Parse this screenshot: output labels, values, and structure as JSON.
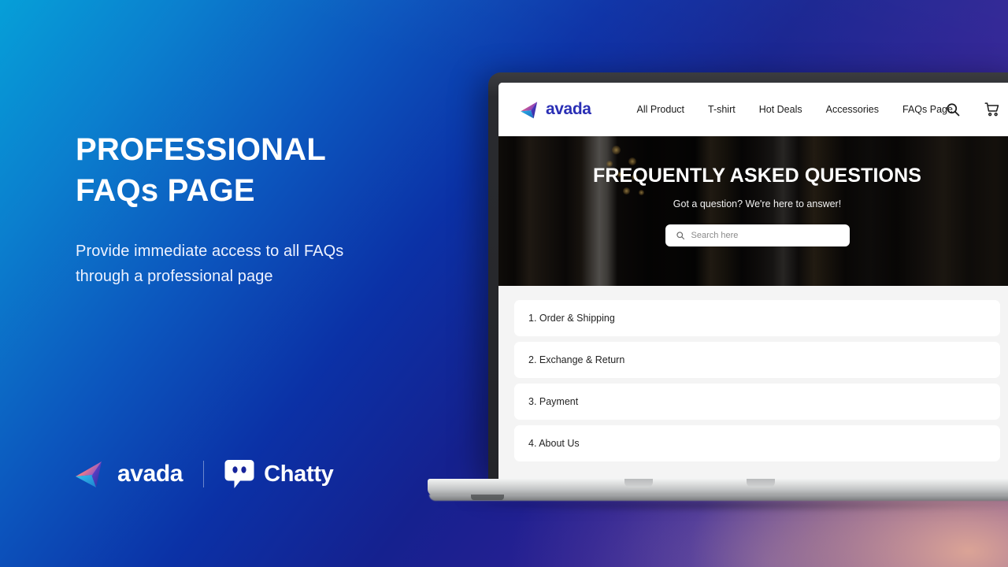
{
  "background": {
    "gradient_from": "#069fd8",
    "gradient_mid": "#0b31a6",
    "gradient_to": "#4a1f9e",
    "glow_warm": "#e2aa96"
  },
  "left_panel": {
    "headline_line1": "PROFESSIONAL",
    "headline_line2": "FAQs PAGE",
    "subtext_line1": "Provide immediate access to all FAQs",
    "subtext_line2": "through a professional page"
  },
  "brand_row": {
    "avada": {
      "name": "avada",
      "mark_icon": "avada-paper-plane-icon",
      "mark_color_a": "#f07a80",
      "mark_color_b": "#5b3fd0",
      "mark_color_c": "#1fa9e0"
    },
    "divider": "|",
    "chatty": {
      "name": "Chatty",
      "mark_icon": "chat-bubble-face-icon",
      "mark_color": "#ffffff"
    }
  },
  "laptop": {
    "bezel_color": "#2a2b2f",
    "base_color": "#c2c4c5",
    "site": {
      "nav": {
        "logo_text": "avada",
        "logo_icon": "avada-paper-plane-icon",
        "logo_color": "#2a2fb5",
        "links": [
          {
            "label": "All Product"
          },
          {
            "label": "T-shirt"
          },
          {
            "label": "Hot Deals"
          },
          {
            "label": "Accessories"
          },
          {
            "label": "FAQs Page"
          }
        ],
        "actions": [
          {
            "icon": "search-icon"
          },
          {
            "icon": "shopping-cart-icon"
          }
        ]
      },
      "hero": {
        "title": "FREQUENTLY ASKED QUESTIONS",
        "subtitle": "Got a question? We're here to answer!",
        "search_placeholder": "Search here",
        "search_value": "",
        "search_icon": "search-icon"
      },
      "faq": {
        "section_bg": "#f4f4f4",
        "items": [
          {
            "label": "1. Order & Shipping"
          },
          {
            "label": "2. Exchange & Return"
          },
          {
            "label": "3. Payment"
          },
          {
            "label": "4. About Us"
          }
        ]
      }
    }
  }
}
